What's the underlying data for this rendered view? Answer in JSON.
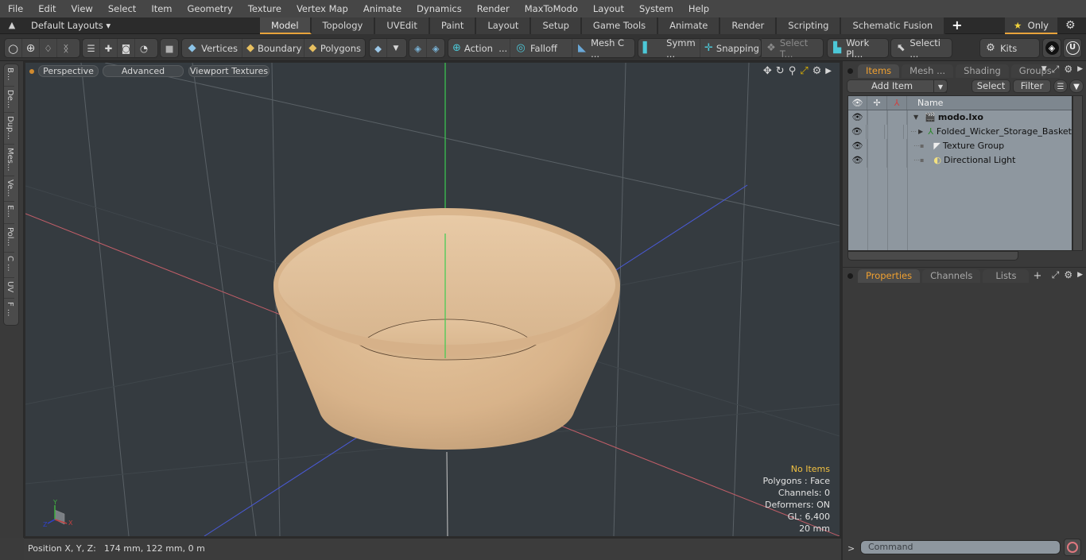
{
  "menubar": [
    "File",
    "Edit",
    "View",
    "Select",
    "Item",
    "Geometry",
    "Texture",
    "Vertex Map",
    "Animate",
    "Dynamics",
    "Render",
    "MaxToModo",
    "Layout",
    "System",
    "Help"
  ],
  "layoutbar": {
    "layout_dropdown": "Default Layouts",
    "tabs": [
      "Model",
      "Topology",
      "UVEdit",
      "Paint",
      "Layout",
      "Setup",
      "Game Tools",
      "Animate",
      "Render",
      "Scripting",
      "Schematic Fusion"
    ],
    "active_tab": "Model",
    "add_tab": "+",
    "only_label": "Only"
  },
  "toolbar": {
    "vertices": "Vertices",
    "boundary": "Boundary",
    "polygons": "Polygons",
    "action": "Action",
    "action_more": "...",
    "falloff": "Falloff",
    "mesh": "Mesh C ...",
    "symm": "Symm ...",
    "snapping": "Snapping",
    "select_t": "Select T...",
    "work_plane": "Work Pl...",
    "selection": "Selecti ...",
    "kits": "Kits"
  },
  "left_strip": [
    "B...",
    "De...",
    "Dup...",
    "Mes...",
    "Ve...",
    "E...",
    "Pol...",
    "C ...",
    "UV",
    "F ..."
  ],
  "viewport": {
    "view_mode": "Perspective",
    "shading": "Advanced",
    "textures": "Viewport Textures",
    "hud": {
      "selection": "No Items",
      "polygons": "Polygons : Face",
      "channels": "Channels: 0",
      "deformers": "Deformers: ON",
      "gl": "GL: 6,400",
      "grid": "20 mm"
    },
    "axis_labels": {
      "x": "X",
      "y": "Y",
      "z": "Z"
    },
    "colors": {
      "x_axis": "#c8505a",
      "y_axis": "#50d050",
      "z_axis": "#4a5ad8",
      "object": "#d9b48a",
      "background": "#353b40"
    }
  },
  "statusbar": {
    "label": "Position X, Y, Z:",
    "value": "174 mm, 122 mm, 0 m"
  },
  "items_panel": {
    "tabs": [
      "Items",
      "Mesh ...",
      "Shading",
      "Groups"
    ],
    "active_tab": "Items",
    "add_item": "Add Item",
    "select": "Select",
    "filter": "Filter",
    "column_name": "Name",
    "tree": [
      {
        "name": "modo.lxo",
        "icon": "scene-icon",
        "bold": true,
        "level": 0
      },
      {
        "name": "Folded_Wicker_Storage_Basket",
        "icon": "mesh-locator-icon",
        "bold": false,
        "level": 1
      },
      {
        "name": "Texture Group",
        "icon": "texture-group-icon",
        "bold": false,
        "level": 1
      },
      {
        "name": "Directional Light",
        "icon": "light-icon",
        "bold": false,
        "level": 1
      }
    ]
  },
  "properties_panel": {
    "tabs": [
      "Properties",
      "Channels",
      "Lists"
    ],
    "active_tab": "Properties",
    "add_tab": "+"
  },
  "command": {
    "prompt": ">",
    "placeholder": "Command"
  },
  "accent": "#e8a33b"
}
